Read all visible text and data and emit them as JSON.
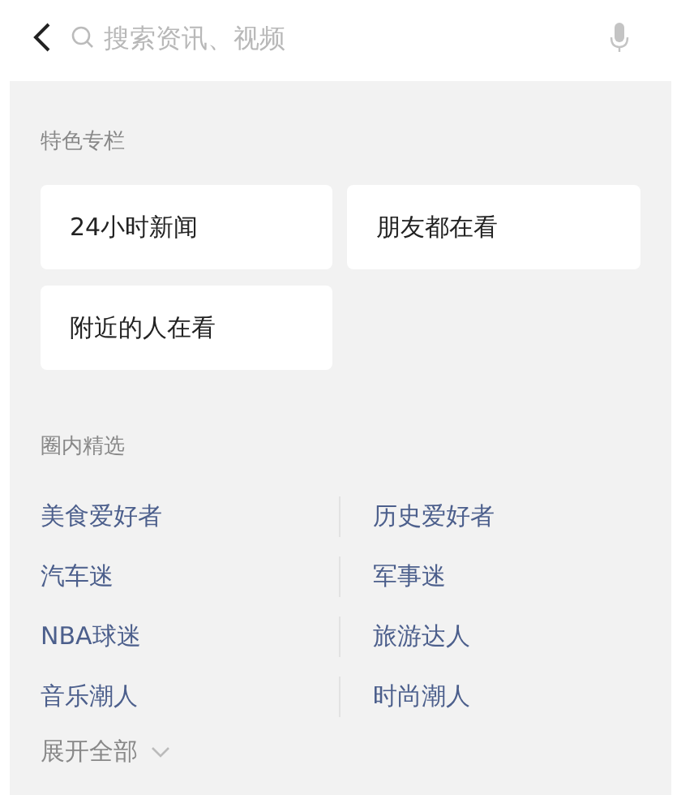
{
  "search": {
    "placeholder": "搜索资讯、视频"
  },
  "featured": {
    "title": "特色专栏",
    "cards": [
      "24小时新闻",
      "朋友都在看",
      "附近的人在看"
    ]
  },
  "circles": {
    "title": "圈内精选",
    "items": [
      "美食爱好者",
      "历史爱好者",
      "汽车迷",
      "军事迷",
      "NBA球迷",
      "旅游达人",
      "音乐潮人",
      "时尚潮人"
    ],
    "expand": "展开全部"
  }
}
